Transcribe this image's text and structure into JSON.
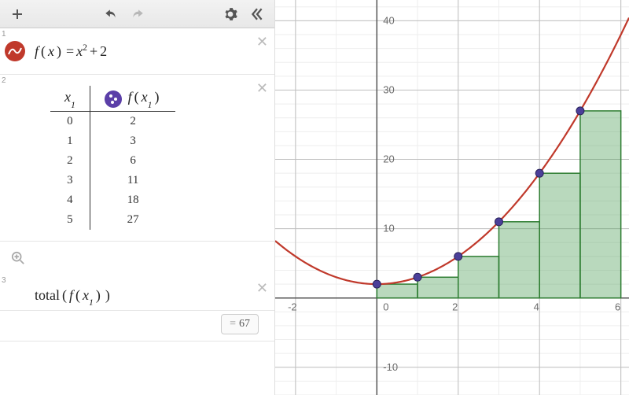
{
  "expressions": [
    {
      "index": "1",
      "formula_html": "<span>f</span><span class='op'>(</span><span>x</span><span class='op'>)</span><span class='op'>=</span><span>x</span><sup class='upright'>2</sup><span class='op'>+</span><span class='upright'>2</span>"
    },
    {
      "index": "2"
    },
    {
      "index": "3",
      "formula_html": "<span class='upright'>total</span><span class='op'>(</span><span>f</span><span class='op'>(</span><span>x</span><sub>1</sub><span class='op'>)</span><span class='op'>)</span>"
    }
  ],
  "table": {
    "header_x": "x₁",
    "header_fx_html": "<span>f</span><span class='op'>(</span><span>x</span><sub>1</sub><span class='op'>)</span>",
    "rows": [
      {
        "x": "0",
        "fx": "2"
      },
      {
        "x": "1",
        "fx": "3"
      },
      {
        "x": "2",
        "fx": "6"
      },
      {
        "x": "3",
        "fx": "11"
      },
      {
        "x": "4",
        "fx": "18"
      },
      {
        "x": "5",
        "fx": "27"
      }
    ]
  },
  "result": {
    "eq": "=",
    "value": "67"
  },
  "chart_data": {
    "type": "line",
    "title": "",
    "xlabel": "",
    "ylabel": "",
    "xlim": [
      -2.5,
      6.2
    ],
    "ylim": [
      -14,
      43
    ],
    "xticks": [
      -2,
      0,
      2,
      4,
      6
    ],
    "yticks": [
      -10,
      10,
      20,
      30,
      40
    ],
    "grid_minor": 1,
    "series": [
      {
        "name": "f(x)=x^2+2",
        "type": "curve",
        "color": "#c0392b",
        "formula": "x*x+2"
      },
      {
        "name": "riemann-bars",
        "type": "bars",
        "color": "rgba(80,160,90,0.4)",
        "stroke": "#2e7d32",
        "x": [
          0,
          1,
          2,
          3,
          4,
          5
        ],
        "y": [
          2,
          3,
          6,
          11,
          18,
          27
        ]
      },
      {
        "name": "points",
        "type": "scatter",
        "color": "#4b3f99",
        "x": [
          0,
          1,
          2,
          3,
          4,
          5
        ],
        "y": [
          2,
          3,
          6,
          11,
          18,
          27
        ]
      }
    ]
  }
}
